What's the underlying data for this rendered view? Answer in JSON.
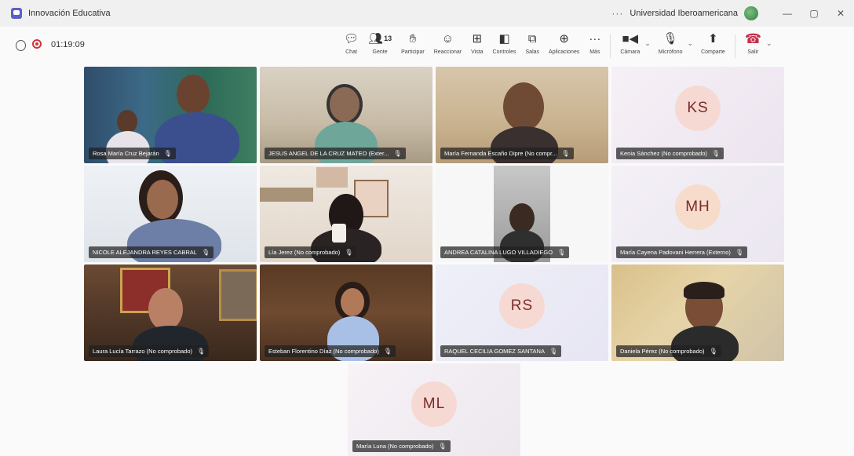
{
  "window": {
    "title": "Innovación Educativa",
    "more": "···",
    "org": "Universidad Iberoamericana",
    "min": "—",
    "restore": "▢",
    "close": "✕"
  },
  "meeting": {
    "timer": "01:19:09"
  },
  "toolbar": {
    "chat": "Chat",
    "people": "Gente",
    "people_count": "13",
    "raise": "Participar",
    "react": "Reaccionar",
    "view": "Vista",
    "controls": "Controles",
    "rooms": "Salas",
    "apps": "Aplicaciones",
    "more": "Más",
    "camera": "Cámara",
    "mic": "Micrófono",
    "share": "Comparte",
    "leave": "Salir"
  },
  "tiles": [
    {
      "name": "Rosa María Cruz Bejarán",
      "video": true
    },
    {
      "name": "JESUS ANGEL DE LA CRUZ MATEO (Exter...",
      "video": true
    },
    {
      "name": "María Fernanda Escaño Dipre (No compr...",
      "video": true
    },
    {
      "name": "Kenia Sánchez (No comprobado)",
      "initials": "KS",
      "video": false
    },
    {
      "name": "NICOLE ALEJANDRA REYES CABRAL",
      "video": true
    },
    {
      "name": "Lía Jerez (No comprobado)",
      "video": true
    },
    {
      "name": "ANDREA CATALINA LUGO VILLADIEGO",
      "video": true
    },
    {
      "name": "María Cayena Padovani Herrera (Externo)",
      "initials": "MH",
      "video": false
    },
    {
      "name": "Laura Lucía Tarrazo (No comprobado)",
      "video": true
    },
    {
      "name": "Esteban Florentino Díaz (No comprobado)",
      "video": true
    },
    {
      "name": "RAQUEL CECILIA GOMEZ SANTANA",
      "initials": "RS",
      "video": false
    },
    {
      "name": "Daniela Pérez (No comprobado)",
      "video": true
    },
    {
      "name": "María Luna (No comprobado)",
      "initials": "ML",
      "video": false
    }
  ],
  "colors": {
    "accent": "#5b5fc7",
    "record": "#d13438",
    "leave": "#c4314b",
    "avatar_bg": "#f6d9d3",
    "avatar_text": "#7a2b2b"
  }
}
